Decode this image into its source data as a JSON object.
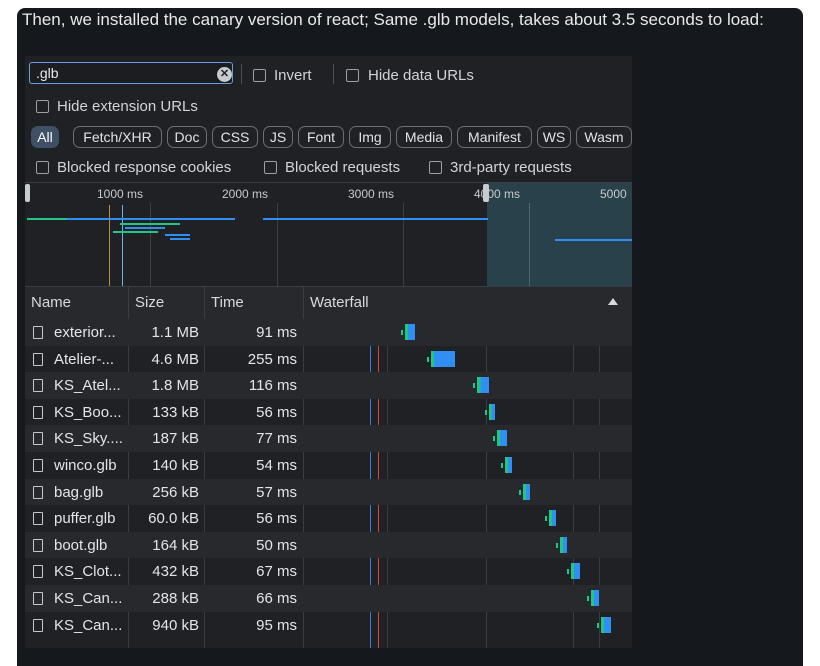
{
  "caption": "Then, we installed the canary version of react; Same .glb models, takes about 3.5 seconds to load:",
  "filter": {
    "value": ".glb",
    "invert_label": "Invert",
    "hide_data_urls_label": "Hide data URLs",
    "hide_extension_urls_label": "Hide extension URLs"
  },
  "type_filters": [
    "All",
    "Fetch/XHR",
    "Doc",
    "CSS",
    "JS",
    "Font",
    "Img",
    "Media",
    "Manifest",
    "WS",
    "Wasm"
  ],
  "checkboxes": {
    "blocked_cookies": "Blocked response cookies",
    "blocked_requests": "Blocked requests",
    "third_party": "3rd-party requests"
  },
  "overview": {
    "ticks": [
      "1000 ms",
      "2000 ms",
      "3000 ms",
      "4000 ms",
      "5000"
    ]
  },
  "table": {
    "headers": {
      "name": "Name",
      "size": "Size",
      "time": "Time",
      "waterfall": "Waterfall"
    },
    "rows": [
      {
        "name": "exterior...",
        "size": "1.1 MB",
        "time": "91 ms"
      },
      {
        "name": "Atelier-...",
        "size": "4.6 MB",
        "time": "255 ms"
      },
      {
        "name": "KS_Atel...",
        "size": "1.8 MB",
        "time": "116 ms"
      },
      {
        "name": "KS_Boo...",
        "size": "133 kB",
        "time": "56 ms"
      },
      {
        "name": "KS_Sky....",
        "size": "187 kB",
        "time": "77 ms"
      },
      {
        "name": "winco.glb",
        "size": "140 kB",
        "time": "54 ms"
      },
      {
        "name": "bag.glb",
        "size": "256 kB",
        "time": "57 ms"
      },
      {
        "name": "puffer.glb",
        "size": "60.0 kB",
        "time": "56 ms"
      },
      {
        "name": "boot.glb",
        "size": "164 kB",
        "time": "50 ms"
      },
      {
        "name": "KS_Clot...",
        "size": "432 kB",
        "time": "67 ms"
      },
      {
        "name": "KS_Can...",
        "size": "288 kB",
        "time": "66 ms"
      },
      {
        "name": "KS_Can...",
        "size": "940 kB",
        "time": "95 ms"
      }
    ]
  },
  "colors": {
    "accent": "#3e4f66",
    "bar_blue": "#2f8ff3",
    "bar_green": "#1ec882",
    "dom_line": "#3b7bd6",
    "load_line": "#d0483a"
  }
}
